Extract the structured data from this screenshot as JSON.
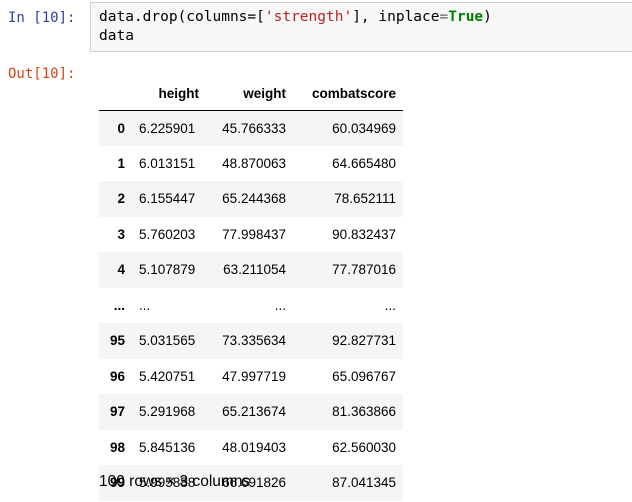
{
  "input_prompt": "In [10]:",
  "output_prompt": "Out[10]:",
  "code": {
    "line1": {
      "p1": "data.drop(columns=[",
      "p2": "'strength'",
      "p3": "], inplace",
      "p4": "=",
      "p5": "True",
      "p6": ")"
    },
    "line2": "data"
  },
  "table": {
    "columns": [
      "height",
      "weight",
      "combatscore"
    ],
    "rows": [
      {
        "index": "0",
        "height": "6.225901",
        "weight": "45.766333",
        "combatscore": "60.034969"
      },
      {
        "index": "1",
        "height": "6.013151",
        "weight": "48.870063",
        "combatscore": "64.665480"
      },
      {
        "index": "2",
        "height": "6.155447",
        "weight": "65.244368",
        "combatscore": "78.652111"
      },
      {
        "index": "3",
        "height": "5.760203",
        "weight": "77.998437",
        "combatscore": "90.832437"
      },
      {
        "index": "4",
        "height": "5.107879",
        "weight": "63.211054",
        "combatscore": "77.787016"
      },
      {
        "index": "...",
        "height": "...",
        "weight": "...",
        "combatscore": "..."
      },
      {
        "index": "95",
        "height": "5.031565",
        "weight": "73.335634",
        "combatscore": "92.827731"
      },
      {
        "index": "96",
        "height": "5.420751",
        "weight": "47.997719",
        "combatscore": "65.096767"
      },
      {
        "index": "97",
        "height": "5.291968",
        "weight": "65.213674",
        "combatscore": "81.363866"
      },
      {
        "index": "98",
        "height": "5.845136",
        "weight": "48.019403",
        "combatscore": "62.560030"
      },
      {
        "index": "99",
        "height": "5.995888",
        "weight": "66.691826",
        "combatscore": "87.041345"
      }
    ]
  },
  "summary": "100 rows × 3 columns",
  "colors": {
    "input_prompt": "#303f9f",
    "output_prompt": "#d84315",
    "string": "#ba2121",
    "keyword": "#008000",
    "cell_background": "#f7f7f7",
    "stripe": "#f5f5f5"
  }
}
